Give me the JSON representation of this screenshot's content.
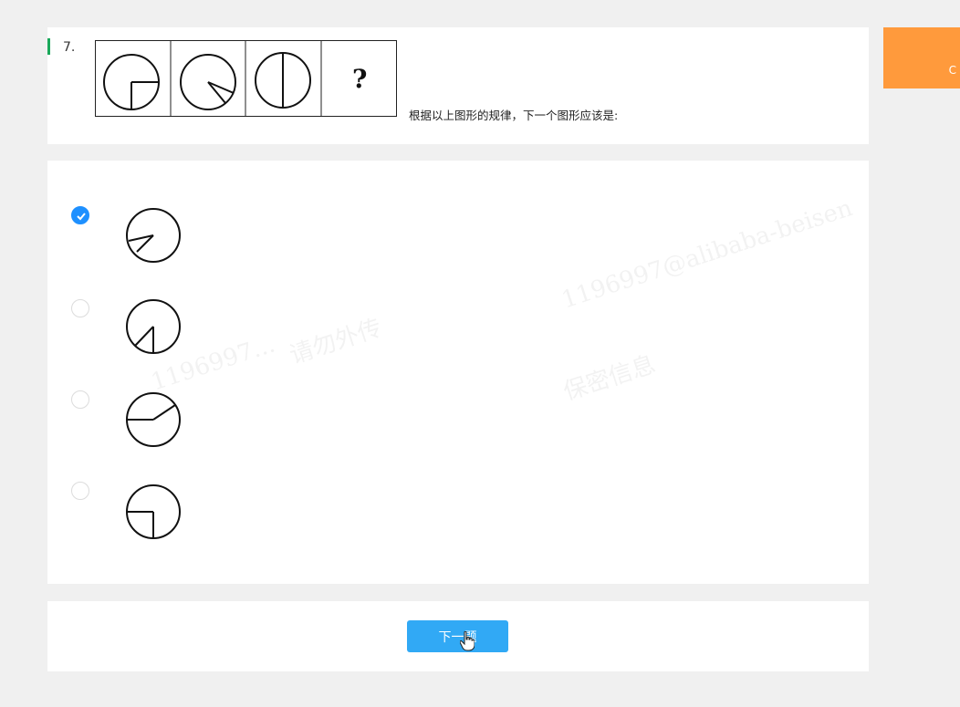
{
  "question": {
    "number": "7.",
    "text": "根据以上图形的规律，下一个图形应该是:",
    "unknown_mark": "?",
    "figure_sequence": [
      "circle-quarter-cut-bottom-right",
      "circle-sector-notch-right",
      "circle-vertical-diameter",
      "question-mark"
    ]
  },
  "options": [
    {
      "selected": true,
      "figure": "circle-notch-lower-left"
    },
    {
      "selected": false,
      "figure": "circle-wedge-lower-left"
    },
    {
      "selected": false,
      "figure": "circle-radius-diagonal-up-right"
    },
    {
      "selected": false,
      "figure": "circle-quarter-cut-lower-left"
    }
  ],
  "footer": {
    "next_label": "下一题"
  },
  "side_button": {
    "label": "C"
  },
  "watermarks": [
    "1196997...",
    "请勿外传",
    "保密信息",
    "1196997@alibaba-beisen"
  ],
  "colors": {
    "accent": "#31a9f5",
    "selected_radio": "#1e90ff",
    "side_button": "#ff9a3c",
    "question_bar": "#1aa85a"
  }
}
